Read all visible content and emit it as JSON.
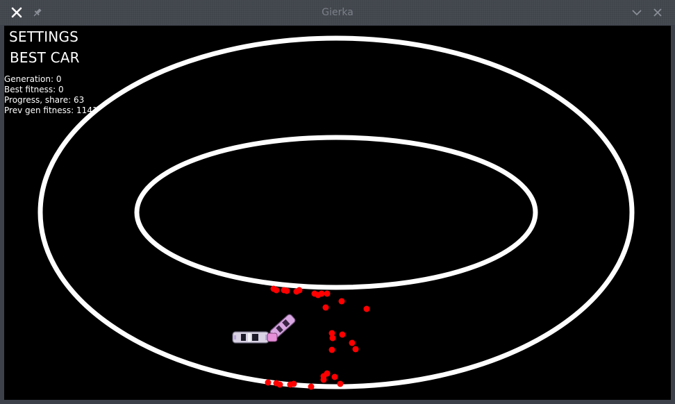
{
  "window": {
    "title": "Gierka"
  },
  "titlebar": {
    "close_icon": "x-icon",
    "pin_icon": "pin-icon",
    "minimize_icon": "chevron-down-icon",
    "close_right_icon": "x-icon"
  },
  "menu": {
    "settings_label": "SETTINGS",
    "best_car_label": "BEST CAR"
  },
  "stats": [
    {
      "label": "Generation:",
      "value": "0"
    },
    {
      "label": "Best fitness:",
      "value": "0"
    },
    {
      "label": "Progress, share:",
      "value": "63"
    },
    {
      "label": "Prev gen fitness:",
      "value": "1141"
    }
  ],
  "colors": {
    "track": "#ffffff",
    "background": "#000000",
    "crash_marker": "#ff0000",
    "car_primary": "#d4c6e6",
    "car_accent": "#e08ad8"
  }
}
